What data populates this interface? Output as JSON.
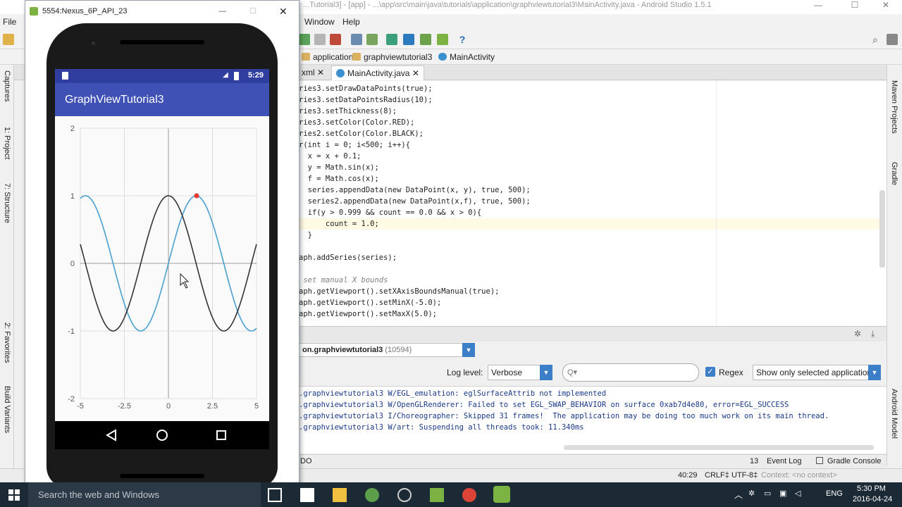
{
  "android_studio": {
    "title": "...Tutorial3] - [app] - ...\\app\\src\\main\\java\\tutorials\\application\\graphviewtutorial3\\MainActivity.java - Android Studio 1.5.1",
    "menu": {
      "file": "File",
      "window": "Window",
      "help": "Help"
    },
    "breadcrumbs": [
      "application",
      "graphviewtutorial3",
      "MainActivity"
    ],
    "tabs": [
      {
        "label": "xml"
      },
      {
        "label": "MainActivity.java"
      }
    ],
    "left_strip": [
      "Captures",
      "1: Project",
      "7: Structure",
      "2: Favorites",
      "Build Variants"
    ],
    "right_strip": [
      "Maven Projects",
      "Gradle",
      "Android Model"
    ],
    "code_lines": [
      "ries3.setDrawDataPoints(true);",
      "ries3.setDataPointsRadius(10);",
      "ries3.setThickness(8);",
      "ries3.setColor(Color.RED);",
      "ries2.setColor(Color.BLACK);",
      "r(int i = 0; i<500; i++){",
      "  x = x + 0.1;",
      "  y = Math.sin(x);",
      "  f = Math.cos(x);",
      "  series.appendData(new DataPoint(x, y), true, 500);",
      "  series2.appendData(new DataPoint(x,f), true, 500);",
      "  if(y > 0.999 && count == 0.0 && x > 0){",
      "      count = 1.0;",
      "  }",
      "",
      "aph.addSeries(series);",
      "",
      " set manual X bounds",
      "aph.getViewport().setXAxisBoundsManual(true);",
      "aph.getViewport().setMinX(-5.0);",
      "aph.getViewport().setMaxX(5.0);"
    ],
    "logcat": {
      "process": "on.graphviewtutorial3",
      "pid": "(10594)",
      "log_level_label": "Log level:",
      "log_level": "Verbose",
      "search_placeholder": "Q▾",
      "regex_label": "Regex",
      "filter": "Show only selected application",
      "lines": [
        ".graphviewtutorial3 W/EGL_emulation: eglSurfaceAttrib not implemented",
        ".graphviewtutorial3 W/OpenGLRenderer: Failed to set EGL_SWAP_BEHAVIOR on surface 0xab7d4e80, error=EGL_SUCCESS",
        ".graphviewtutorial3 I/Choreographer: Skipped 31 frames!  The application may be doing too much work on its main thread.",
        ".graphviewtutorial3 W/art: Suspending all threads took: 11.340ms"
      ]
    },
    "bottom_tabs": {
      "todo": "DO",
      "event_log": "Event Log",
      "event_count": "13",
      "gradle_console": "Gradle Console"
    },
    "status": {
      "position": "40:29",
      "line_sep": "CRLF‡",
      "encoding": "UTF-8‡",
      "context": "Context: <no context>"
    }
  },
  "emulator": {
    "window_title": "5554:Nexus_6P_API_23",
    "status_time": "5:29",
    "app_title": "GraphViewTutorial3"
  },
  "chart_data": {
    "type": "line",
    "x_range": [
      -5,
      5
    ],
    "y_range": [
      -2,
      2
    ],
    "x_ticks": [
      "-5",
      "-2.5",
      "0",
      "2.5",
      "5"
    ],
    "y_ticks": [
      "2",
      "1",
      "0",
      "-1",
      "-2"
    ],
    "grid": true,
    "series": [
      {
        "color": "#4a9fd0",
        "function": "sin"
      },
      {
        "color": "#333333",
        "function": "cos"
      }
    ],
    "highlight_point": {
      "x": 1.6,
      "y": 1.0,
      "color": "#e53935"
    }
  },
  "taskbar": {
    "search_text": "Search the web and Windows",
    "language": "ENG",
    "time": "5:30 PM",
    "date": "2016-04-24"
  }
}
